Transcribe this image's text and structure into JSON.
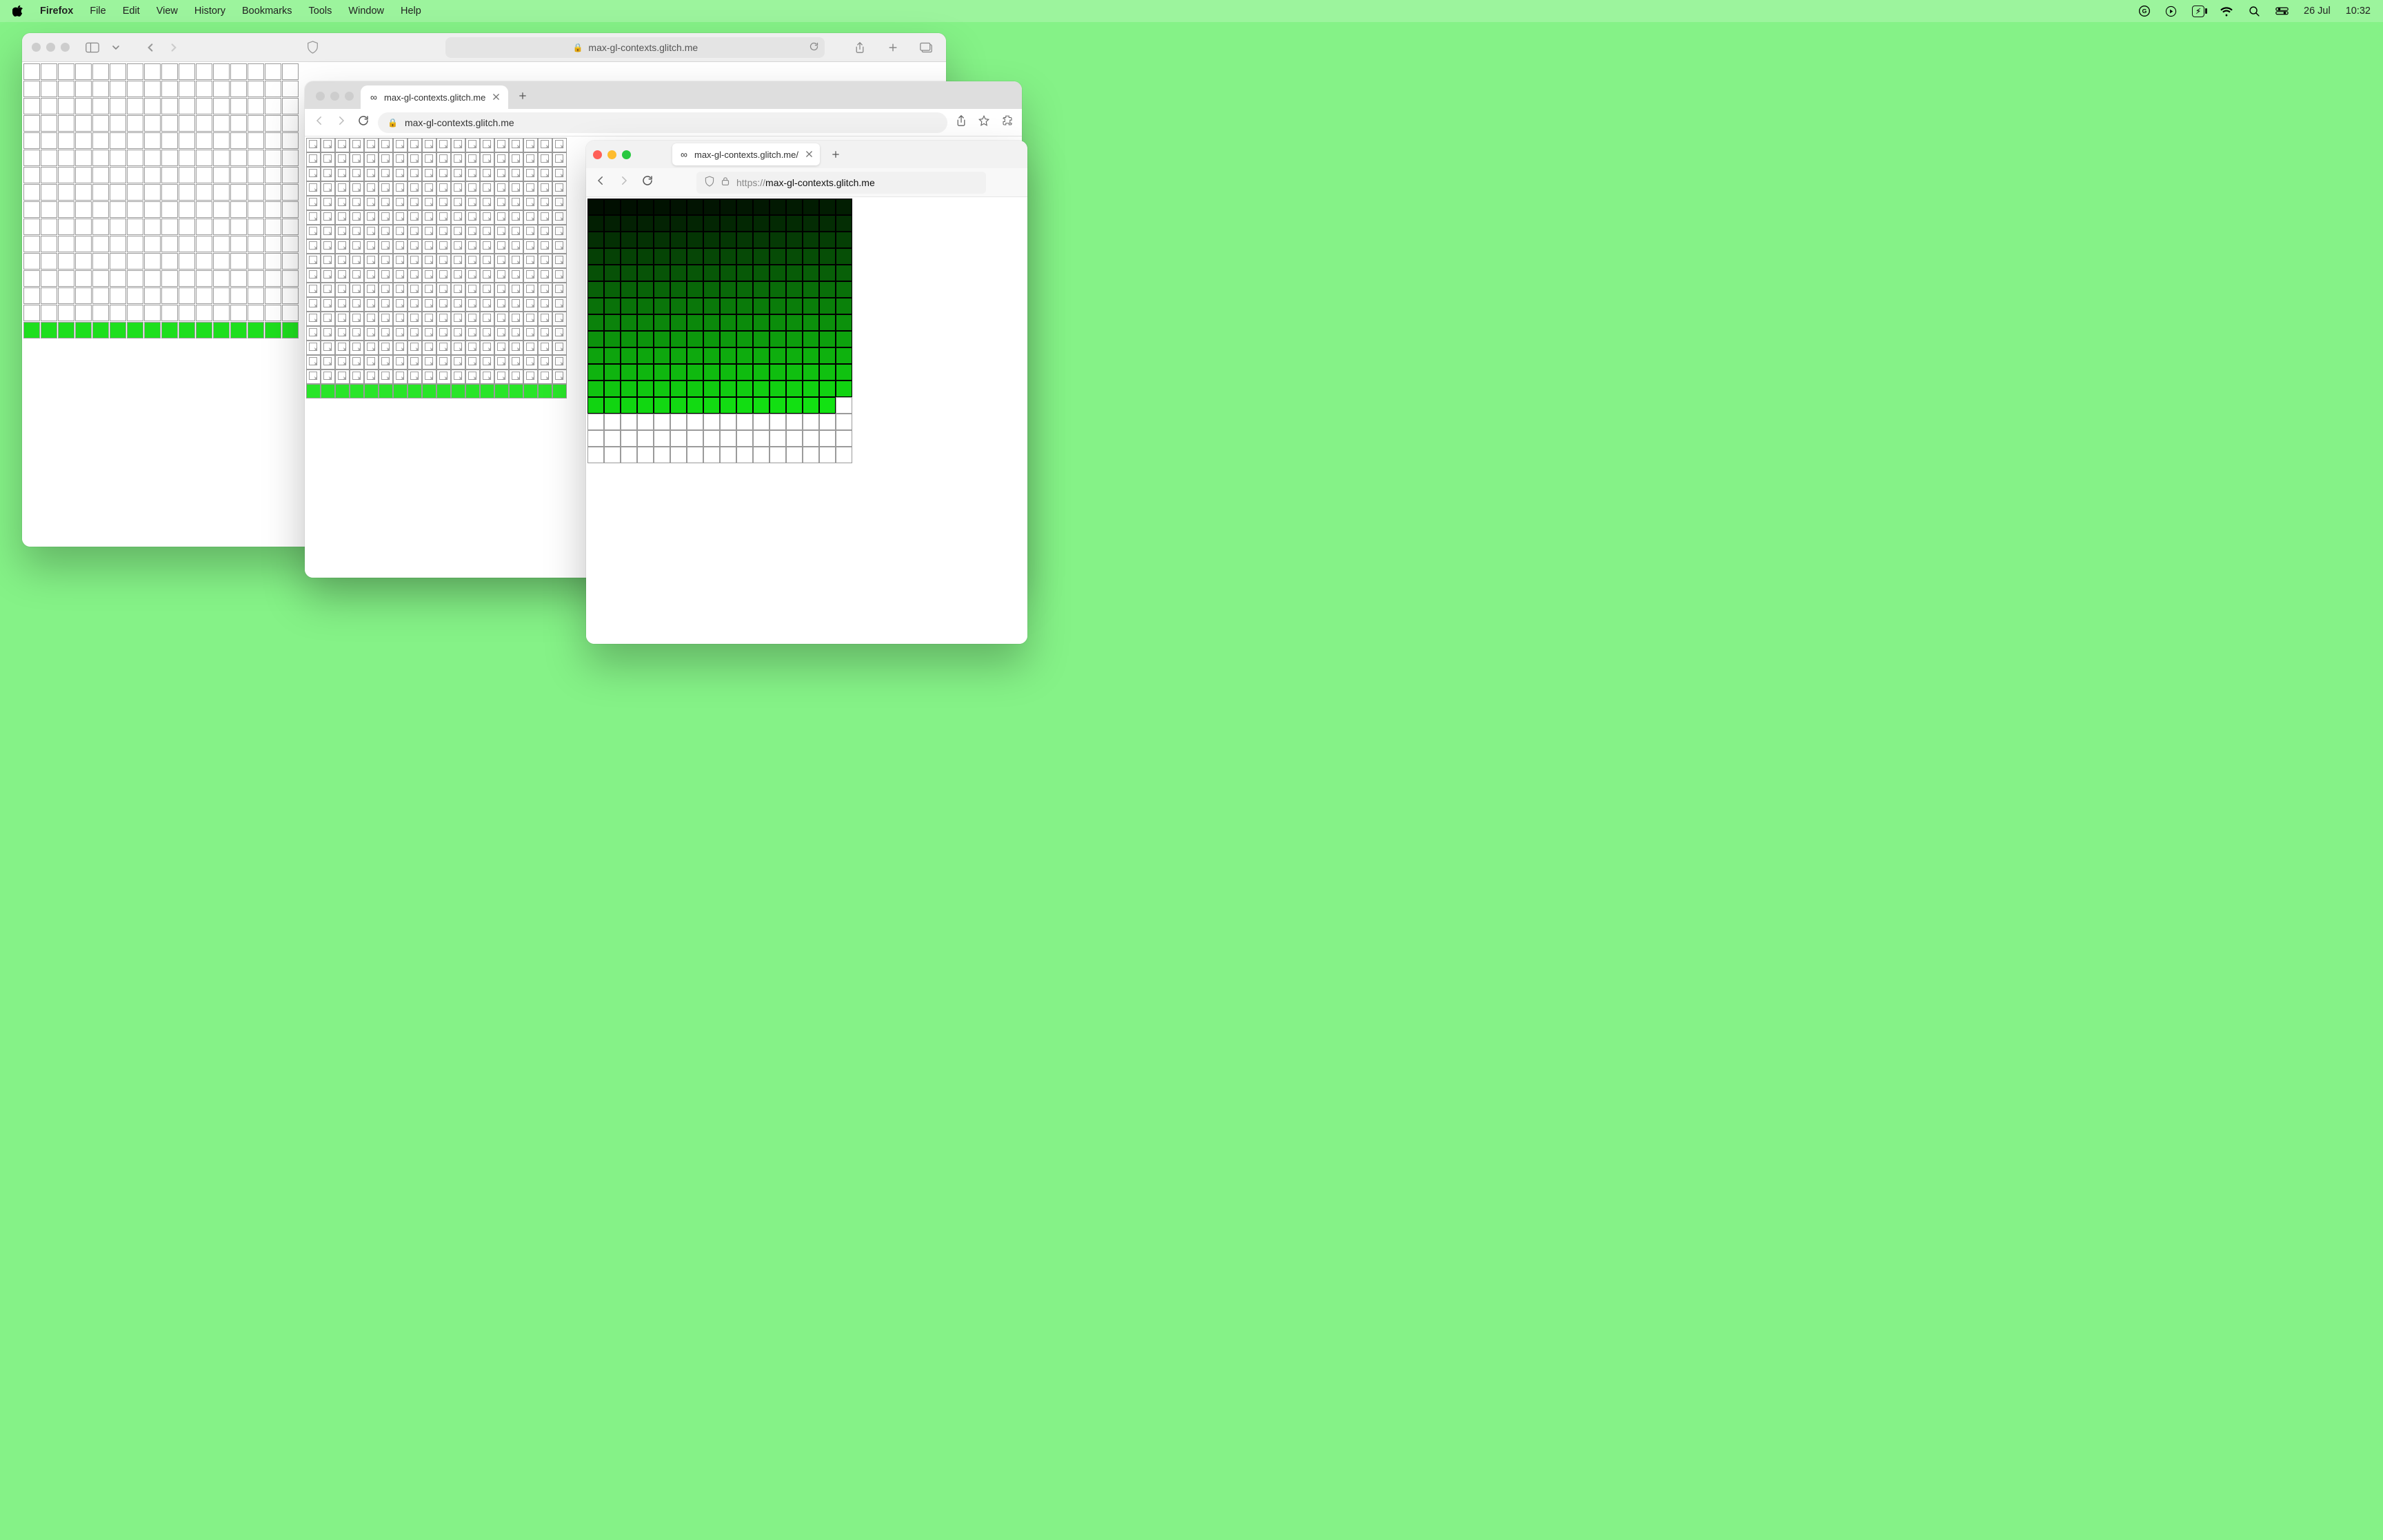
{
  "menubar": {
    "app": "Firefox",
    "items": [
      "File",
      "Edit",
      "View",
      "History",
      "Bookmarks",
      "Tools",
      "Window",
      "Help"
    ],
    "battery_icon": "⚡︎",
    "date": "26 Jul",
    "time": "10:32"
  },
  "safari": {
    "shield_tooltip": "Privacy Report",
    "lock_glyph": "🔒",
    "address_host": "max-gl-contexts.glitch.me",
    "grid": {
      "cols": 16,
      "rows": 16,
      "cell": 24,
      "filled_count": 16
    }
  },
  "chrome": {
    "favicon": "∞",
    "tab_title": "max-gl-contexts.glitch.me",
    "lock_glyph": "🔒",
    "address_host": "max-gl-contexts.glitch.me",
    "grid": {
      "cols": 18,
      "rows": 18,
      "cell": 21,
      "broken_rows": 17,
      "filled_count": 18
    }
  },
  "firefox": {
    "favicon": "∞",
    "tab_title": "max-gl-contexts.glitch.me/",
    "url_scheme_prefix": "https://",
    "url_host": "max-gl-contexts.glitch.me",
    "grid": {
      "cols": 16,
      "rows": 16,
      "cell": 24,
      "gradient_count": 207
    }
  }
}
